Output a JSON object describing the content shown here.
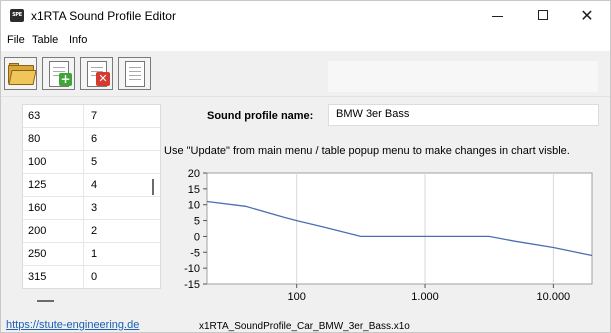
{
  "window": {
    "title": "x1RTA Sound Profile Editor",
    "app_icon_text": "SPE"
  },
  "menu": {
    "file": "File",
    "table": "Table",
    "info": "Info"
  },
  "toolbar": {
    "icons": [
      "folder-open-icon",
      "new-document-icon",
      "delete-document-icon",
      "document-icon"
    ]
  },
  "table": {
    "rows": [
      {
        "freq": "63",
        "value": "7"
      },
      {
        "freq": "80",
        "value": "6"
      },
      {
        "freq": "100",
        "value": "5"
      },
      {
        "freq": "125",
        "value": "4"
      },
      {
        "freq": "160",
        "value": "3"
      },
      {
        "freq": "200",
        "value": "2"
      },
      {
        "freq": "250",
        "value": "1"
      },
      {
        "freq": "315",
        "value": "0"
      }
    ]
  },
  "profile": {
    "label": "Sound profile name:",
    "name": "BMW 3er Bass"
  },
  "info_text": "Use \"Update\" from main menu / table popup menu to make changes in chart visble.",
  "chart_data": {
    "type": "line",
    "x_scale": "log",
    "xlim": [
      20,
      20000
    ],
    "ylim": [
      -15,
      20
    ],
    "y_ticks": [
      20,
      15,
      10,
      5,
      0,
      -5,
      -10,
      -15
    ],
    "x_ticks": [
      {
        "value": 100,
        "label": "100"
      },
      {
        "value": 1000,
        "label": "1.000"
      },
      {
        "value": 10000,
        "label": "10.000"
      }
    ],
    "grid": true,
    "line_color": "#4a6fb0",
    "series": [
      {
        "x": [
          20,
          40,
          80,
          100,
          160,
          315,
          3150,
          5000,
          10000,
          20000
        ],
        "y": [
          11,
          9.5,
          6,
          5,
          3,
          0,
          0,
          -1.5,
          -3.5,
          -6
        ]
      }
    ]
  },
  "status": {
    "link": "https://stute-engineering.de",
    "file": "x1RTA_SoundProfile_Car_BMW_3er_Bass.x1o"
  }
}
